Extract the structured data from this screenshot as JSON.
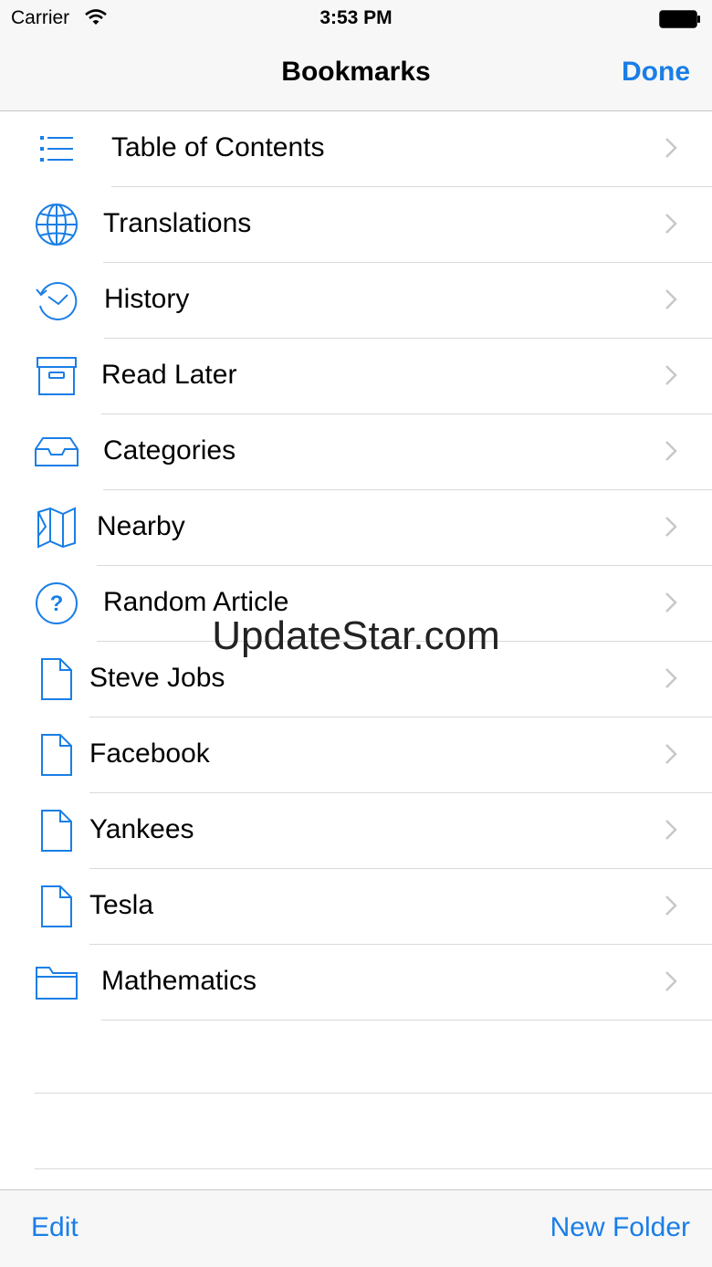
{
  "status_bar": {
    "carrier": "Carrier",
    "time": "3:53 PM"
  },
  "nav_bar": {
    "title": "Bookmarks",
    "done_label": "Done"
  },
  "items": [
    {
      "label": "Table of Contents",
      "icon": "list-icon"
    },
    {
      "label": "Translations",
      "icon": "globe-icon"
    },
    {
      "label": "History",
      "icon": "history-clock-icon"
    },
    {
      "label": "Read Later",
      "icon": "archive-box-icon"
    },
    {
      "label": "Categories",
      "icon": "inbox-tray-icon"
    },
    {
      "label": "Nearby",
      "icon": "map-icon"
    },
    {
      "label": "Random Article",
      "icon": "question-circle-icon"
    },
    {
      "label": "Steve Jobs",
      "icon": "document-icon"
    },
    {
      "label": "Facebook",
      "icon": "document-icon"
    },
    {
      "label": "Yankees",
      "icon": "document-icon"
    },
    {
      "label": "Tesla",
      "icon": "document-icon"
    },
    {
      "label": "Mathematics",
      "icon": "folder-icon"
    }
  ],
  "toolbar": {
    "edit_label": "Edit",
    "new_folder_label": "New Folder"
  },
  "watermark": "UpdateStar.com",
  "colors": {
    "accent": "#1a7ee6",
    "separator": "#d9d9dd",
    "bar_background": "#f7f7f7"
  }
}
